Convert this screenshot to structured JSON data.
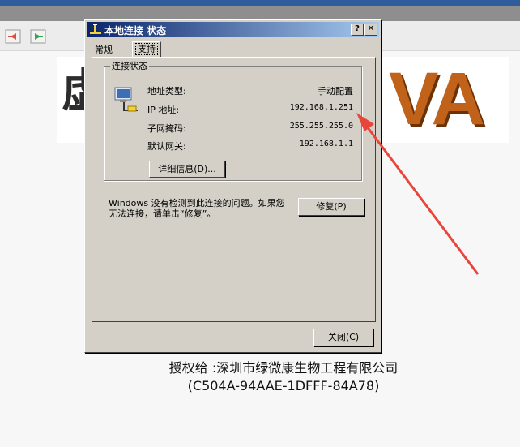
{
  "dialog": {
    "title": "本地连接 状态",
    "help_button": "?",
    "close_button": "✕",
    "tabs": {
      "general": "常规",
      "support": "支持"
    },
    "group_title": "连接状态",
    "rows": [
      {
        "label": "地址类型:",
        "value": "手动配置"
      },
      {
        "label": "IP 地址:",
        "value": "192.168.1.251"
      },
      {
        "label": "子网掩码:",
        "value": "255.255.255.0"
      },
      {
        "label": "默认网关:",
        "value": "192.168.1.1"
      }
    ],
    "details_button": "详细信息(D)...",
    "repair_text": "Windows 没有检测到此连接的问题。如果您无法连接，请单击“修复”。",
    "repair_button": "修复(P)",
    "close_dialog_button": "关闭(C)"
  },
  "background": {
    "banner_left_text": "虚",
    "banner_right_text": "VA",
    "license_line1": "授权给 :深圳市绿微康生物工程有限公司",
    "license_line2": "(C504A-94AAE-1DFFF-84A78)"
  },
  "colors": {
    "titlebar_start": "#0a246a",
    "titlebar_end": "#a6caf0",
    "dialog_face": "#d4d0c8",
    "banner_accent": "#c1621b",
    "annotation_arrow": "#e8463a"
  },
  "icons": [
    "back-arrow-icon",
    "forward-arrow-icon",
    "network-connection-icon",
    "lan-icon"
  ]
}
